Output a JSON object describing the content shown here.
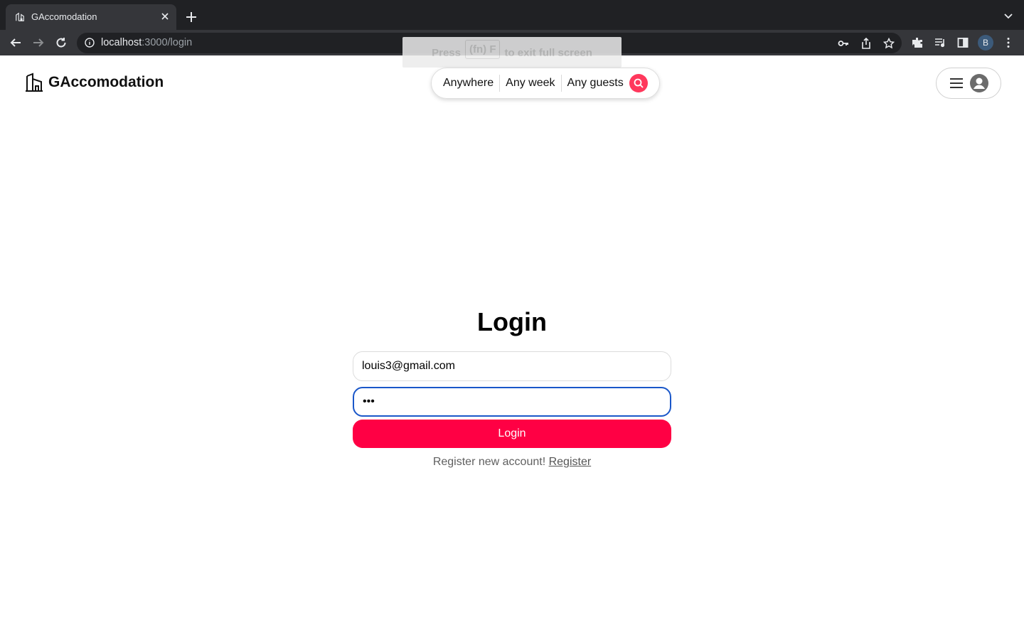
{
  "browser": {
    "tab_title": "GAccomodation",
    "url_host": "localhost",
    "url_path": ":3000/login",
    "profile_initial": "B",
    "fullscreen_hint": {
      "before": "Press",
      "key": "(fn) F",
      "after": "to exit full screen"
    }
  },
  "header": {
    "brand": "GAccomodation",
    "search": {
      "where": "Anywhere",
      "when": "Any week",
      "who": "Any guests"
    }
  },
  "login": {
    "title": "Login",
    "email_value": "louis3@gmail.com",
    "password_value": "•••",
    "button_label": "Login",
    "register_prompt": "Register new account!",
    "register_link": "Register"
  },
  "colors": {
    "accent": "#ff0044",
    "search_accent": "#ff385c",
    "focus_ring": "#1a57c9"
  }
}
